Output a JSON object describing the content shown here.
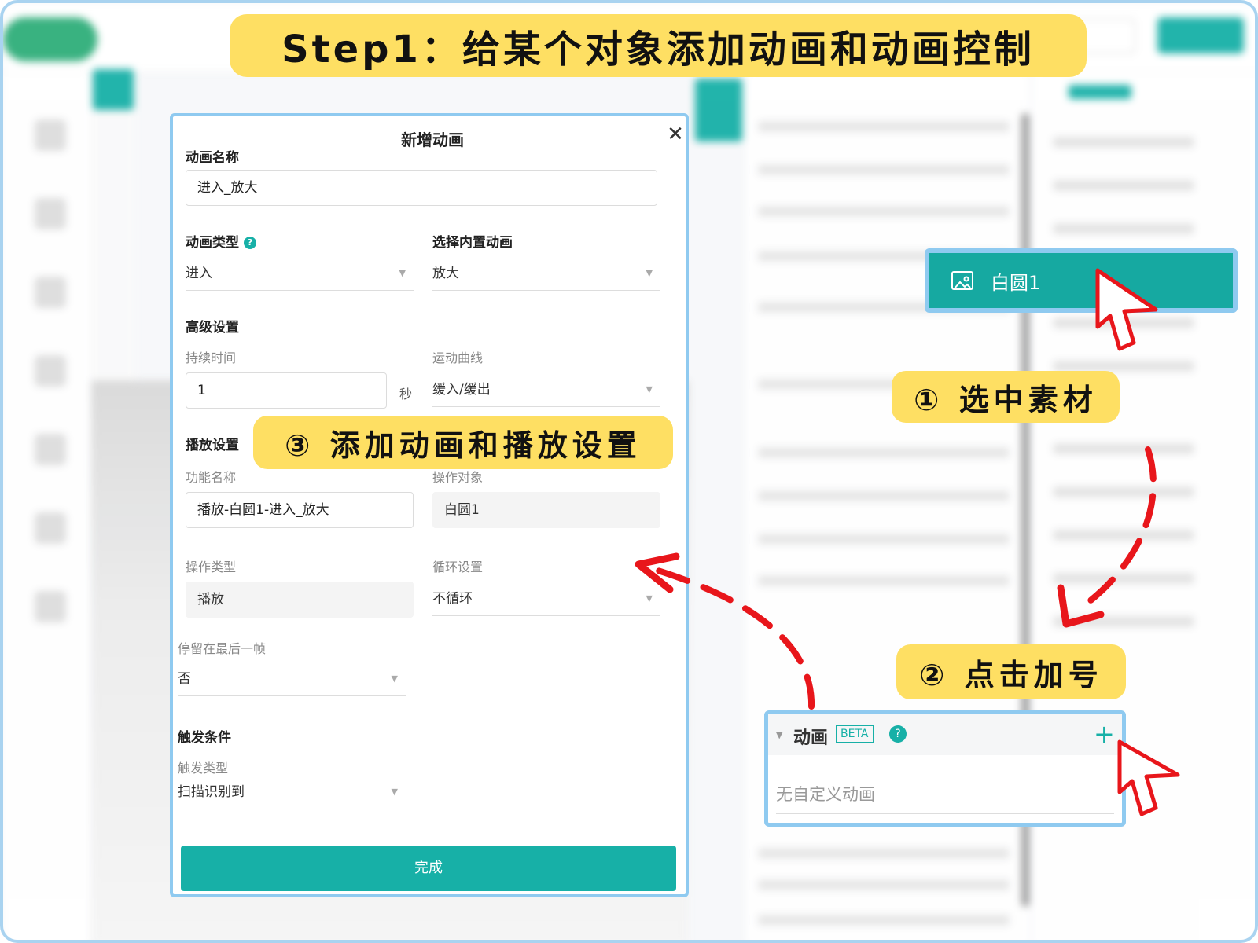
{
  "banner": {
    "title": "Step1：给某个对象添加动画和动画控制"
  },
  "dialog": {
    "title": "新增动画",
    "name_label": "动画名称",
    "name_value": "进入_放大",
    "type_label": "动画类型",
    "type_value": "进入",
    "builtin_label": "选择内置动画",
    "builtin_value": "放大",
    "advanced_label": "高级设置",
    "duration_label": "持续时间",
    "duration_value": "1",
    "duration_unit": "秒",
    "curve_label": "运动曲线",
    "curve_value": "缓入/缓出",
    "play_label": "播放设置",
    "func_name_label": "功能名称",
    "func_name_value": "播放-白圆1-进入_放大",
    "target_label": "操作对象",
    "target_value": "白圆1",
    "op_type_label": "操作类型",
    "op_type_value": "播放",
    "loop_label": "循环设置",
    "loop_value": "不循环",
    "stay_label": "停留在最后一帧",
    "stay_value": "否",
    "trigger_label": "触发条件",
    "trigger_type_label": "触发类型",
    "trigger_type_value": "扫描识别到",
    "finish_label": "完成"
  },
  "callouts": {
    "step1": "① 选中素材",
    "step2": "② 点击加号",
    "step3": "③ 添加动画和播放设置"
  },
  "asset": {
    "label": "白圆1",
    "icon": "image-icon"
  },
  "anim_panel": {
    "title": "动画",
    "badge": "BETA",
    "empty_text": "无自定义动画"
  },
  "colors": {
    "accent": "#17b0a7",
    "highlight": "#fedf63",
    "frame": "#8fcaf0",
    "arrow": "#e8161b"
  }
}
